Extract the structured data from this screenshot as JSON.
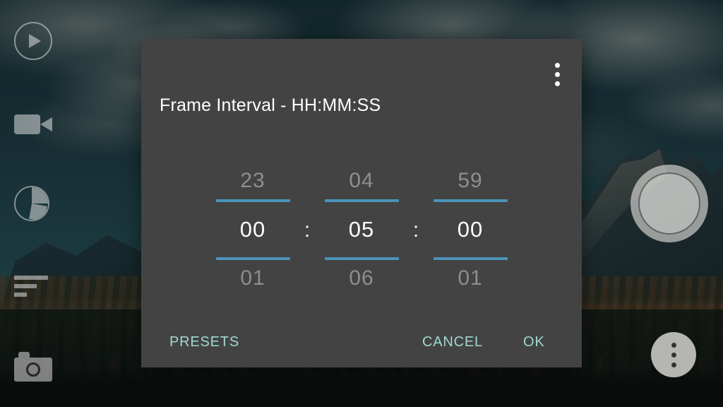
{
  "background": {
    "scene_description": "mountain landscape with autumn forest",
    "colors": {
      "sky": "#1d4049",
      "forest": "#2a1c10",
      "mountain": "#30444a"
    }
  },
  "left_toolbar": {
    "items": [
      {
        "name": "play-icon",
        "label": "Play"
      },
      {
        "name": "video-camera-icon",
        "label": "Video"
      },
      {
        "name": "pie-clock-icon",
        "label": "Interval"
      },
      {
        "name": "sort-settings-icon",
        "label": "Settings"
      },
      {
        "name": "camera-icon",
        "label": "Camera"
      }
    ]
  },
  "right_controls": {
    "shutter_label": "Shutter",
    "overflow_label": "More options"
  },
  "dialog": {
    "title": "Frame Interval - HH:MM:SS",
    "overflow_icon": "more-vert-icon",
    "accent_color": "#4a93b8",
    "button_color": "#9fd8ce",
    "background_color": "#434343",
    "picker": {
      "columns": [
        {
          "unit": "hours",
          "previous": "23",
          "selected": "00",
          "next": "01"
        },
        {
          "unit": "minutes",
          "previous": "04",
          "selected": "05",
          "next": "06"
        },
        {
          "unit": "seconds",
          "previous": "59",
          "selected": "00",
          "next": "01"
        }
      ],
      "separator": ":"
    },
    "actions": {
      "presets": "PRESETS",
      "cancel": "CANCEL",
      "ok": "OK"
    }
  }
}
